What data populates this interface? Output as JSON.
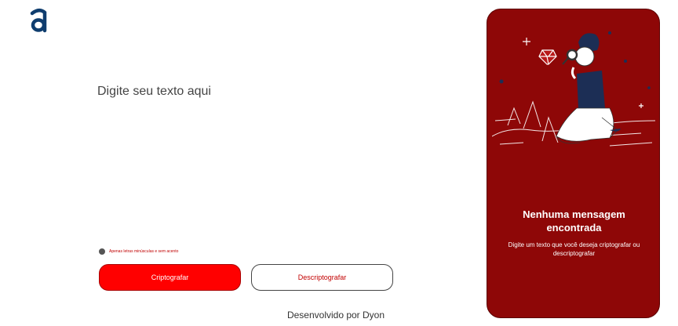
{
  "brand": {
    "logo_letter": "a",
    "logo_color": "#0f3d6e"
  },
  "input": {
    "placeholder": "Digite seu texto aqui",
    "value": ""
  },
  "hint": {
    "icon": "info-icon",
    "text": "Apenas letras minúsculas e sem acento"
  },
  "buttons": {
    "encrypt_label": "Criptografar",
    "decrypt_label": "Descriptografar"
  },
  "footer": {
    "text": "Desenvolvido por Dyon"
  },
  "output_panel": {
    "title": "Nenhuma mensagem encontrada",
    "description": "Digite um texto que você deseja criptografar ou descriptografar",
    "illustration": "person-with-magnifying-glass-and-diamond",
    "background_color": "#8e0707"
  },
  "colors": {
    "accent": "#ff0000",
    "accent_text": "#c20000",
    "panel": "#8e0707"
  }
}
